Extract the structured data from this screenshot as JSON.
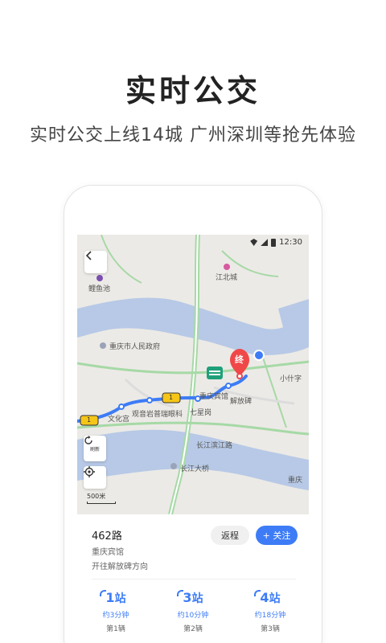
{
  "promo": {
    "title": "实时公交",
    "subtitle": "实时公交上线14城 广州深圳等抢先体验"
  },
  "status_bar": {
    "time": "12:30"
  },
  "map": {
    "labels": {
      "liyuchi": "鲤鱼池",
      "jiangbeicheng": "江北城",
      "government": "重庆市人民政府",
      "xiaoshizi": "小什字",
      "hotel": "重庆宾馆",
      "jiefangbei": "解放碑",
      "wenhuagong": "文化宫",
      "guanyinyan": "观音岩普瑞眼科",
      "qixinggang": "七星岗",
      "changjiang_road": "长江滨江路",
      "changjiang_bridge": "长江大桥",
      "chongqing_right": "重庆"
    },
    "end_marker": "终",
    "refresh_label": "刷新",
    "scale": "500米",
    "bus_labels": [
      "1",
      "1"
    ]
  },
  "route": {
    "name": "462路",
    "stop": "重庆宾馆",
    "direction": "开往解放碑方向",
    "return_label": "返程",
    "follow_label": "+ 关注"
  },
  "arrivals": [
    {
      "stops": "1",
      "unit": "站",
      "time": "约3分钟",
      "nth": "第1辆"
    },
    {
      "stops": "3",
      "unit": "站",
      "time": "约10分钟",
      "nth": "第2辆"
    },
    {
      "stops": "4",
      "unit": "站",
      "time": "约18分钟",
      "nth": "第3辆"
    }
  ],
  "colors": {
    "accent": "#3d7cf6",
    "end_marker": "#f04848",
    "bus": "#f5c518",
    "river": "#b7c9e6",
    "road_green": "#a6d9a6"
  }
}
